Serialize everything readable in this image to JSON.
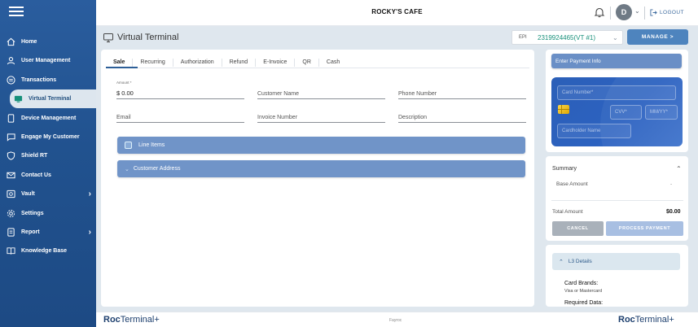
{
  "app": {
    "brand": "ROCKY'S CAFE"
  },
  "sidebar": {
    "items": [
      {
        "label": "Home",
        "icon": "home-icon"
      },
      {
        "label": "User Management",
        "icon": "user-icon"
      },
      {
        "label": "Transactions",
        "icon": "transactions-icon"
      },
      {
        "label": "Virtual Terminal",
        "icon": "terminal-icon",
        "active": true
      },
      {
        "label": "Device Management",
        "icon": "device-icon"
      },
      {
        "label": "Engage My Customer",
        "icon": "chat-icon"
      },
      {
        "label": "Shield RT",
        "icon": "shield-icon"
      },
      {
        "label": "Contact Us",
        "icon": "mail-icon"
      },
      {
        "label": "Vault",
        "icon": "vault-icon",
        "expandable": true
      },
      {
        "label": "Settings",
        "icon": "gear-icon"
      },
      {
        "label": "Report",
        "icon": "report-icon",
        "expandable": true
      },
      {
        "label": "Knowledge Base",
        "icon": "book-icon"
      }
    ]
  },
  "header": {
    "avatar_initial": "D",
    "logout_label": "LOGOUT"
  },
  "page": {
    "title": "Virtual Terminal",
    "epi_label": "EPI",
    "epi_value": "2319924465(VT #1)",
    "manage_label": "MANAGE  >"
  },
  "tabs": [
    "Sale",
    "Recurring",
    "Authorization",
    "Refund",
    "E-Invoice",
    "QR",
    "Cash"
  ],
  "form": {
    "amount_label": "Amount *",
    "amount_value": "$ 0.00",
    "customer_name": "Customer Name",
    "phone_number": "Phone Number",
    "email": "Email",
    "invoice_number": "Invoice Number",
    "description": "Description",
    "line_items": "Line Items",
    "customer_address": "Customer Address"
  },
  "payment": {
    "header": "Enter Payment Info",
    "card_number": "Card Number*",
    "cvv": "CVV*",
    "expiry": "MM/YY*",
    "cardholder": "Cardholder Name"
  },
  "summary": {
    "title": "Summary",
    "base_label": "Base Amount",
    "base_value": "-",
    "total_label": "Total Amount",
    "total_value": "$0.00",
    "cancel": "CANCEL",
    "process": "PROCESS PAYMENT"
  },
  "l3": {
    "title": "L3 Details",
    "card_brands_title": "Card Brands:",
    "card_brands_value": "Visa or Mastercard",
    "required_title": "Required Data:"
  },
  "footer": {
    "logo_bold": "Roc",
    "logo_rest": "Terminal+",
    "middle": "Fayroc"
  },
  "colors": {
    "sidebar": "#2a5d9e",
    "accent": "#4e84be",
    "epi_text": "#17907a",
    "accordion": "#7094c8"
  }
}
